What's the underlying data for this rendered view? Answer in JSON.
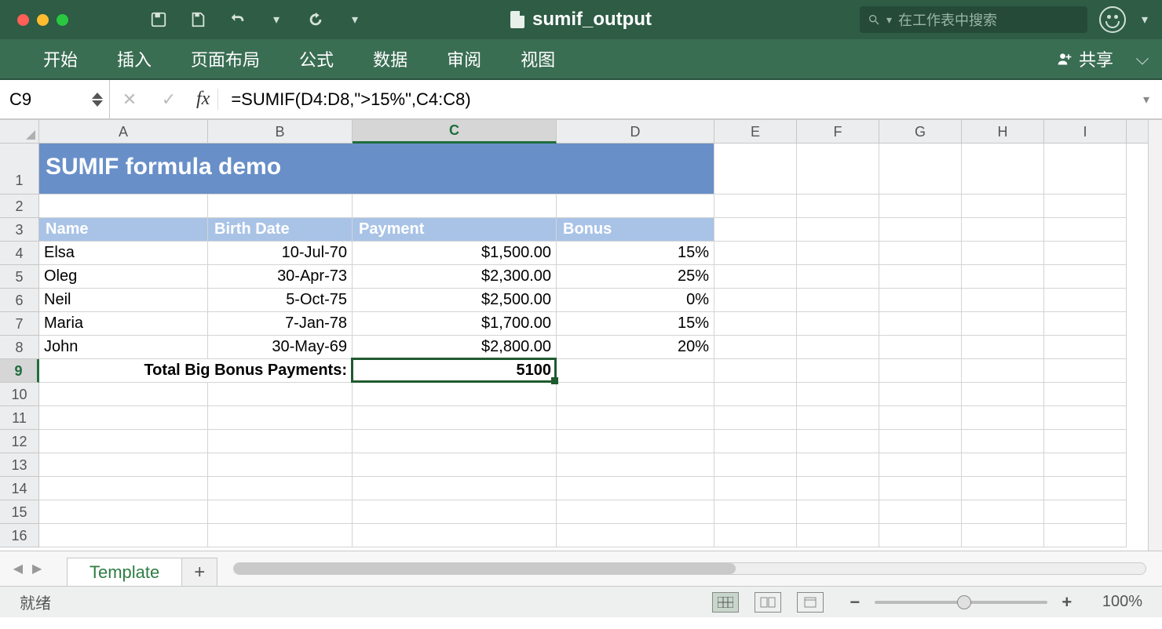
{
  "title": "sumif_output",
  "search_placeholder": "在工作表中搜索",
  "ribbon": {
    "tabs": [
      "开始",
      "插入",
      "页面布局",
      "公式",
      "数据",
      "审阅",
      "视图"
    ],
    "share": "共享"
  },
  "formula_bar": {
    "name": "C9",
    "formula": "=SUMIF(D4:D8,\">15%\",C4:C8)"
  },
  "columns": [
    "A",
    "B",
    "C",
    "D",
    "E",
    "F",
    "G",
    "H",
    "I"
  ],
  "col_classes": [
    "cA",
    "cB",
    "cC",
    "cD",
    "cRest",
    "cRest",
    "cRest",
    "cRest",
    "cRest"
  ],
  "selected_col_idx": 2,
  "selected_row": 9,
  "rowcount": 16,
  "chart_data": {
    "type": "table",
    "title": "SUMIF formula demo",
    "headers": [
      "Name",
      "Birth Date",
      "Payment",
      "Bonus"
    ],
    "rows": [
      {
        "name": "Elsa",
        "birth": "10-Jul-70",
        "payment": "$1,500.00",
        "bonus": "15%"
      },
      {
        "name": "Oleg",
        "birth": "30-Apr-73",
        "payment": "$2,300.00",
        "bonus": "25%"
      },
      {
        "name": "Neil",
        "birth": "5-Oct-75",
        "payment": "$2,500.00",
        "bonus": "0%"
      },
      {
        "name": "Maria",
        "birth": "7-Jan-78",
        "payment": "$1,700.00",
        "bonus": "15%"
      },
      {
        "name": "John",
        "birth": "30-May-69",
        "payment": "$2,800.00",
        "bonus": "20%"
      }
    ],
    "total_label": "Total Big Bonus Payments:",
    "total_value": "5100"
  },
  "sheet_tab": "Template",
  "status": "就绪",
  "zoom": "100%"
}
